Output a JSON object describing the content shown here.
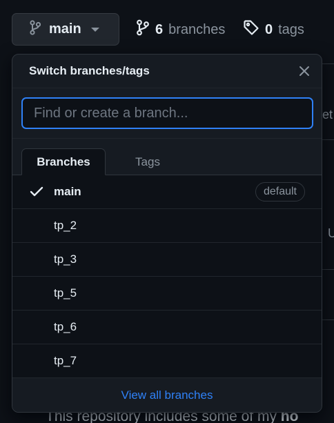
{
  "toolbar": {
    "branch_button_label": "main",
    "branches_count": "6",
    "branches_label": "branches",
    "tags_count": "0",
    "tags_label": "tags"
  },
  "background": {
    "right_fragment_1": "et",
    "right_fragment_2": "U",
    "bottom_text_plain": "This repository includes some of my ",
    "bottom_text_bold": "ho"
  },
  "popup": {
    "title": "Switch branches/tags",
    "search": {
      "placeholder": "Find or create a branch...",
      "value": ""
    },
    "tabs": [
      {
        "label": "Branches",
        "active": true
      },
      {
        "label": "Tags",
        "active": false
      }
    ],
    "branches": [
      {
        "name": "main",
        "current": true,
        "badge": "default"
      },
      {
        "name": "tp_2",
        "current": false,
        "badge": ""
      },
      {
        "name": "tp_3",
        "current": false,
        "badge": ""
      },
      {
        "name": "tp_5",
        "current": false,
        "badge": ""
      },
      {
        "name": "tp_6",
        "current": false,
        "badge": ""
      },
      {
        "name": "tp_7",
        "current": false,
        "badge": ""
      }
    ],
    "footer_link": "View all branches"
  },
  "icons": {
    "branch": "git-branch-icon",
    "tag": "tag-icon",
    "close": "close-icon",
    "check": "check-icon",
    "caret": "triangle-down-icon"
  },
  "colors": {
    "accent": "#2f81f7",
    "background": "#0d1117",
    "overlay": "#161b22",
    "border": "#30363d",
    "muted": "#8b949e"
  }
}
